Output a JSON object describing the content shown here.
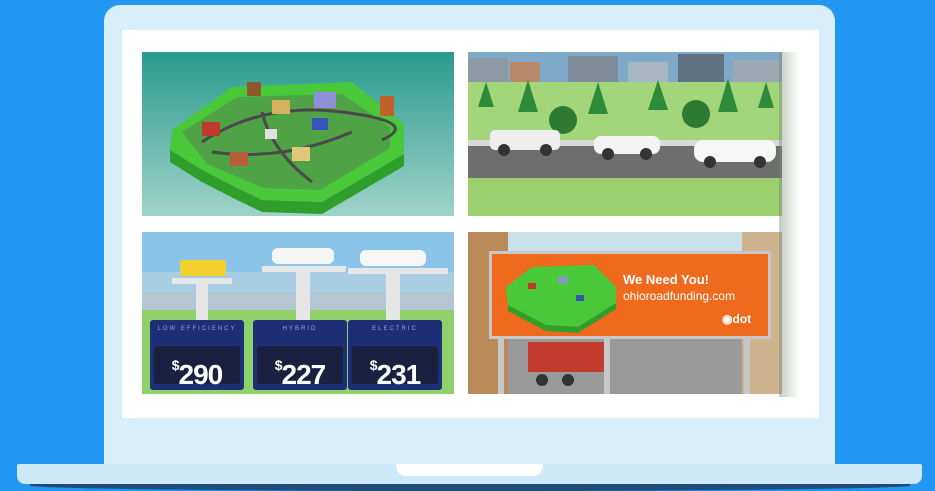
{
  "prices": [
    {
      "label": "LOW EFFICIENCY",
      "currency": "$",
      "amount": "290"
    },
    {
      "label": "HYBRID",
      "currency": "$",
      "amount": "227"
    },
    {
      "label": "ELECTRIC",
      "currency": "$",
      "amount": "231"
    }
  ],
  "billboard": {
    "headline": "We Need You!",
    "url": "ohioroadfunding.com",
    "brand": "dot"
  },
  "colors": {
    "background": "#2196f3",
    "billboard": "#f06a1e",
    "price_box": "#1e2f78"
  }
}
